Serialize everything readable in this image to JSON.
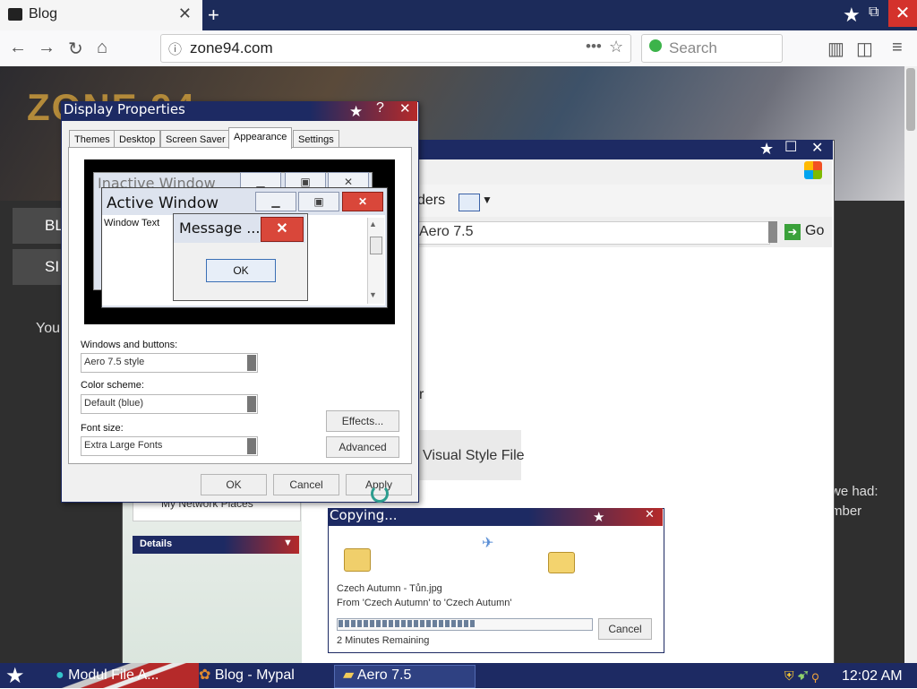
{
  "browser": {
    "tab_title": "Blog",
    "tab_close": "✕",
    "new_tab": "+",
    "url": "zone94.com",
    "search_placeholder": "Search",
    "window_restore": "⧉",
    "window_close": "✕"
  },
  "page": {
    "logo_text": "ZONE 94",
    "button_blog": "BL",
    "button_sign": "SI",
    "you_text": "You",
    "right_text_1": "we had:",
    "right_text_2": "mber"
  },
  "explorer": {
    "folders_label": "ders",
    "address_value": "Aero 7.5",
    "go_label": "Go",
    "item_r": "r",
    "visual_style_label": "Visual Style File",
    "network_places": "My Network Places",
    "details_label": "Details"
  },
  "display_properties": {
    "title": "Display Properties",
    "tabs": [
      "Themes",
      "Desktop",
      "Screen Saver",
      "Appearance",
      "Settings"
    ],
    "active_tab": "Appearance",
    "preview": {
      "inactive_title": "Inactive Window",
      "active_title": "Active Window",
      "window_text": "Window Text",
      "message_title": "Message ...",
      "ok_label": "OK"
    },
    "windows_buttons_label": "Windows and buttons:",
    "windows_buttons_value": "Aero 7.5 style",
    "color_scheme_label": "Color scheme:",
    "color_scheme_value": "Default (blue)",
    "font_size_label": "Font size:",
    "font_size_value": "Extra Large Fonts",
    "effects_label": "Effects...",
    "advanced_label": "Advanced",
    "ok_label": "OK",
    "cancel_label": "Cancel",
    "apply_label": "Apply"
  },
  "copying": {
    "title": "Copying...",
    "file_line": "Czech Autumn - Tůn.jpg",
    "from_line": "From 'Czech Autumn' to 'Czech Autumn'",
    "remaining": "2 Minutes Remaining",
    "cancel_label": "Cancel",
    "progress": 0.54
  },
  "taskbar": {
    "item1": "Modul File A...",
    "item2": "Blog - Mypal",
    "item3": "Aero 7.5",
    "clock": "12:02 AM"
  },
  "colors": {
    "titlebar": "#1d2a63",
    "accent_red": "#b52a2a",
    "close_red": "#d4322c"
  }
}
